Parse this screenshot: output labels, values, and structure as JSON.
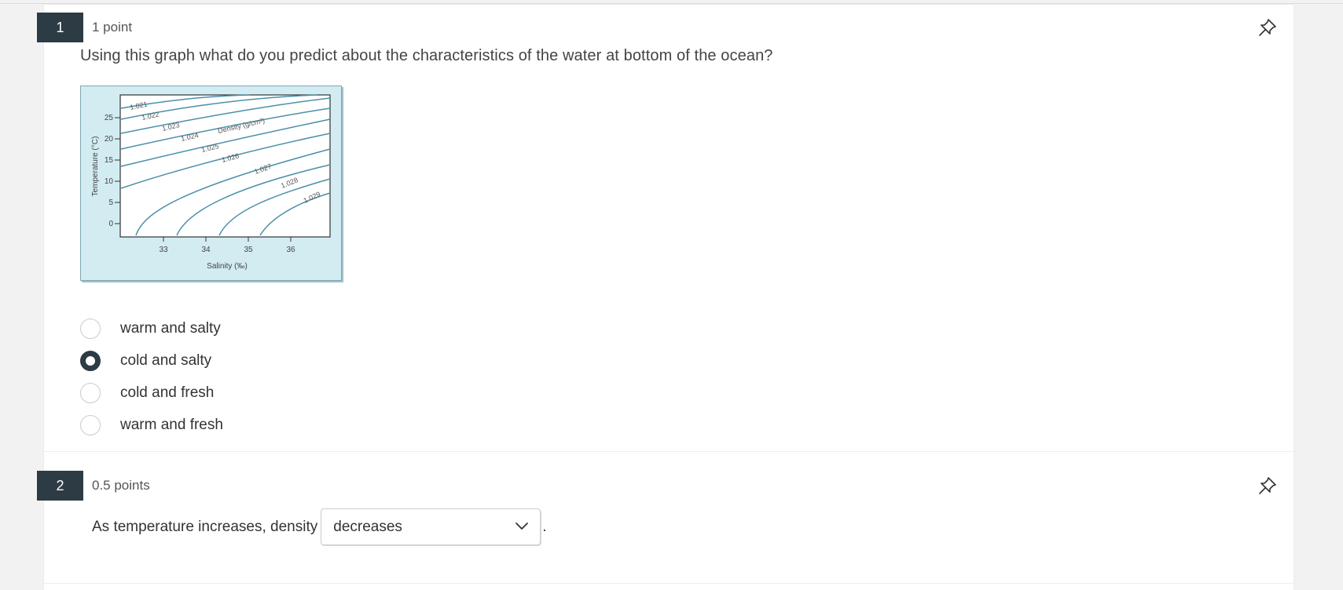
{
  "questions": [
    {
      "number": "1",
      "points": "1 point",
      "text": "Using this graph what do you predict about the characteristics of the water at bottom of the ocean?",
      "graph": {
        "ylabel": "Temperature (°C)",
        "xlabel": "Salinity (‰)",
        "y_ticks": [
          "25",
          "20",
          "15",
          "10",
          "5",
          "0"
        ],
        "x_ticks": [
          "33",
          "34",
          "35",
          "36"
        ],
        "density_label": "Density (g/cm³)",
        "density_curves": [
          "1.021",
          "1.022",
          "1.023",
          "1.024",
          "1.025",
          "1.026",
          "1.027",
          "1.028",
          "1.029"
        ]
      },
      "options": [
        {
          "label": "warm and salty",
          "selected": false
        },
        {
          "label": "cold and salty",
          "selected": true
        },
        {
          "label": "cold and fresh",
          "selected": false
        },
        {
          "label": "warm and fresh",
          "selected": false
        }
      ]
    },
    {
      "number": "2",
      "points": "0.5 points",
      "prompt": "As temperature increases, density",
      "select_value": "decreases",
      "trailing": "."
    }
  ],
  "icons": {
    "pin": "pin-icon",
    "dropdown": "chevron-down-icon"
  },
  "colors": {
    "badge": "#2d3b45",
    "graph_bg": "#d2ecf2",
    "curve": "#4a8fa8"
  }
}
